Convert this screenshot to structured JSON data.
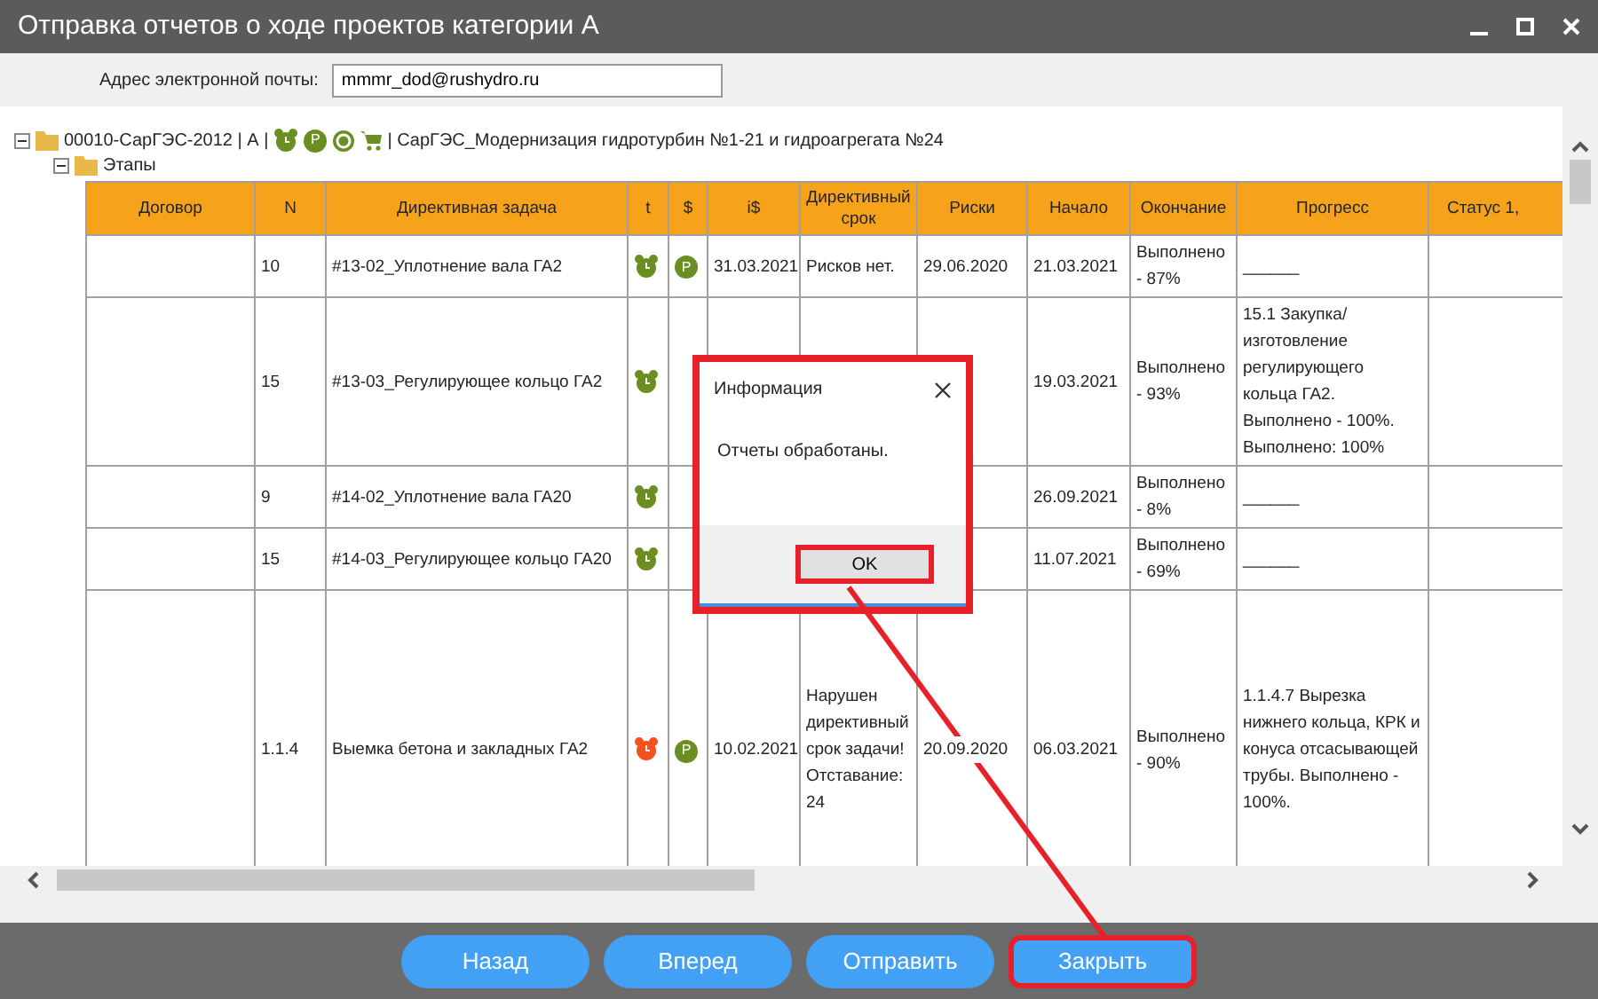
{
  "window": {
    "title": "Отправка отчетов о ходе проектов категории А"
  },
  "email": {
    "label": "Адрес электронной почты:",
    "value": "mmmr_dod@rushydro.ru"
  },
  "tree": {
    "expanded": true,
    "code": "00010-СарГЭС-2012 | А |",
    "badge": "P",
    "project": "| СарГЭС_Модернизация гидротурбин №1-21 и гидроагрегата №24",
    "children": [
      {
        "label": "Этапы",
        "expanded": true
      }
    ]
  },
  "table": {
    "columns": [
      "Договор",
      "N",
      "Директивная задача",
      "t",
      "$",
      "i$",
      "Директивный срок",
      "Риски",
      "Начало",
      "Окончание",
      "Прогресс",
      "Статус 1,"
    ],
    "rows": [
      {
        "n": "10",
        "task": "#13-02_Уплотнение вала ГА2",
        "color": "#6b8e23",
        "payment": "P",
        "i_sum": "31.03.2021",
        "deadline": "Рисков нет.",
        "risks": "29.06.2020",
        "start": "21.03.2021",
        "end": "Выполнено - 87%",
        "progress": "______"
      },
      {
        "n": "15",
        "task": "#13-03_Регулирующее кольцо ГА2",
        "color": "#6b8e23",
        "start": "19.03.2021",
        "end": "Выполнено - 93%",
        "progress": "15.1 Закупка/изготовление регулирующего кольца ГА2. Выполнено - 100%. Выполнено: 100%"
      },
      {
        "n": "9",
        "task": "#14-02_Уплотнение вала ГА20",
        "color": "#6b8e23",
        "start": "26.09.2021",
        "end": "Выполнено - 8%",
        "progress": "______"
      },
      {
        "n": "15",
        "task": "#14-03_Регулирующее кольцо ГА20",
        "color": "#6b8e23",
        "start": "11.07.2021",
        "end": "Выполнено - 69%",
        "progress": "______"
      },
      {
        "n": "1.1.4",
        "task": "Выемка бетона и закладных ГА2",
        "color": "#f4511e",
        "payment": "P",
        "i_sum": "10.02.2021",
        "deadline": "Нарушен директивный срок задачи! Отставание: 24",
        "risks": "20.09.2020",
        "start": "06.03.2021",
        "end": "Выполнено - 90%",
        "progress": "1.1.4.7 Вырезка нижнего кольца, КРК и конуса отсасывающей трубы. Выполнено - 100%."
      }
    ]
  },
  "dialog": {
    "title": "Информация",
    "message": "Отчеты обработаны.",
    "button": "OK",
    "highlighted": true,
    "button_highlighted": true
  },
  "buttons": [
    {
      "label": "Назад",
      "highlighted": false
    },
    {
      "label": "Вперед",
      "highlighted": false
    },
    {
      "label": "Отправить",
      "highlighted": false
    },
    {
      "label": "Закрыть",
      "highlighted": true
    }
  ],
  "leader_line": true
}
